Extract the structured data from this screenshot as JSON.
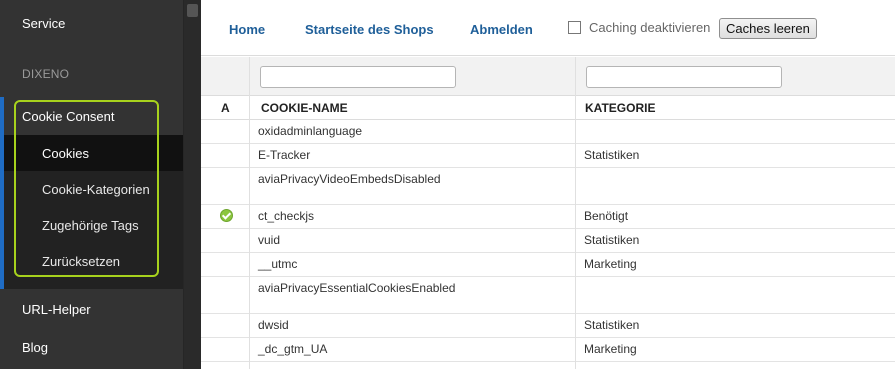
{
  "sidebar": {
    "service": "Service",
    "dixeno": "DIXENO",
    "cookie_consent": {
      "title": "Cookie Consent",
      "items": [
        {
          "label": "Cookies"
        },
        {
          "label": "Cookie-Kategorien"
        },
        {
          "label": "Zugehörige Tags"
        },
        {
          "label": "Zurücksetzen"
        }
      ]
    },
    "url_helper": "URL-Helper",
    "blog": "Blog"
  },
  "topnav": {
    "home": "Home",
    "shop_start": "Startseite des Shops",
    "logout": "Abmelden",
    "caching_label": "Caching deaktivieren",
    "caching_checked": false,
    "clear_caches": "Caches leeren"
  },
  "table": {
    "columns": {
      "active": "A",
      "name": "COOKIE-NAME",
      "category": "KATEGORIE"
    },
    "filters": {
      "name": "",
      "category": ""
    },
    "rows": [
      {
        "active": false,
        "name": "oxidadminlanguage",
        "category": ""
      },
      {
        "active": false,
        "name": "E-Tracker",
        "category": "Statistiken"
      },
      {
        "active": false,
        "name": "aviaPrivacyVideoEmbedsDisabled",
        "category": ""
      },
      {
        "active": true,
        "name": "ct_checkjs",
        "category": "Benötigt"
      },
      {
        "active": false,
        "name": "vuid",
        "category": "Statistiken"
      },
      {
        "active": false,
        "name": "__utmc",
        "category": "Marketing"
      },
      {
        "active": false,
        "name": "aviaPrivacyEssentialCookiesEnabled",
        "category": ""
      },
      {
        "active": false,
        "name": "dwsid",
        "category": "Statistiken"
      },
      {
        "active": false,
        "name": "_dc_gtm_UA",
        "category": "Marketing"
      }
    ]
  },
  "colors": {
    "sidebar_bg": "#333333",
    "accent_blue": "#1f6cc4",
    "highlight_green": "#a7d21d",
    "link_blue": "#1f5f99",
    "active_icon": "#8cc63f"
  },
  "icons": {
    "active_status": "check-circle-icon"
  }
}
